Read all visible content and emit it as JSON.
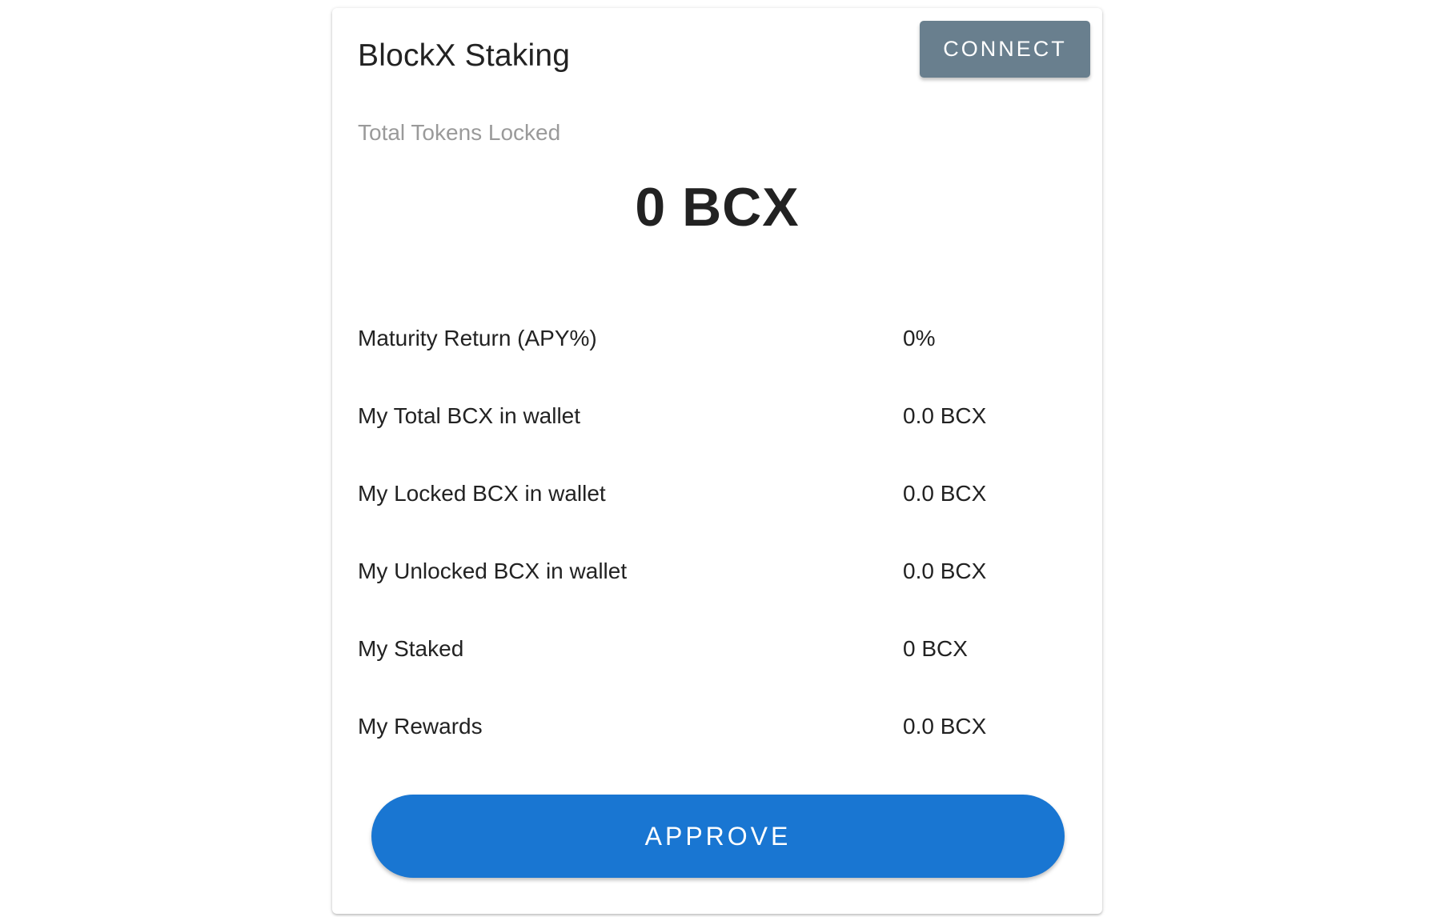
{
  "header": {
    "title": "BlockX Staking",
    "connect_label": "CONNECT"
  },
  "total_locked": {
    "label": "Total Tokens Locked",
    "value": "0 BCX"
  },
  "stats": [
    {
      "label": "Maturity Return (APY%)",
      "value": "0%"
    },
    {
      "label": "My Total BCX in wallet",
      "value": "0.0 BCX"
    },
    {
      "label": "My Locked BCX in wallet",
      "value": "0.0 BCX"
    },
    {
      "label": "My Unlocked BCX in wallet",
      "value": "0.0 BCX"
    },
    {
      "label": "My Staked",
      "value": "0 BCX"
    },
    {
      "label": "My Rewards",
      "value": "0.0 BCX"
    }
  ],
  "approve_label": "APPROVE",
  "colors": {
    "connect_button": "#697f8e",
    "approve_button": "#1976d2",
    "muted_text": "#9a9a9a",
    "primary_text": "#222222"
  }
}
